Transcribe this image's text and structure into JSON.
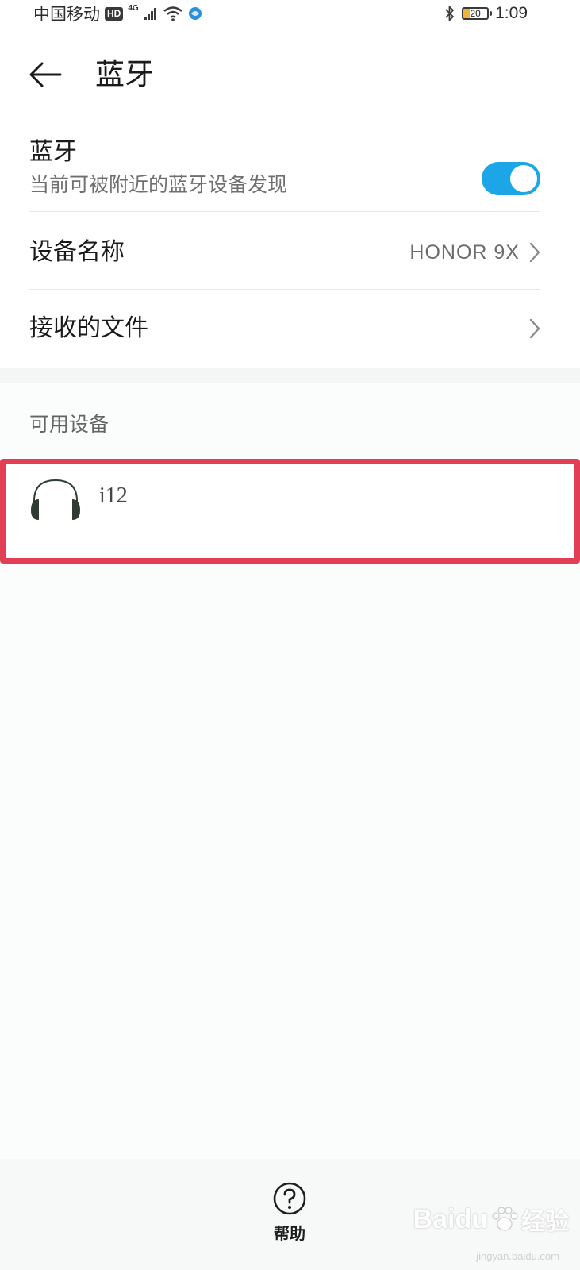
{
  "status_bar": {
    "carrier": "中国移动",
    "hd": "HD",
    "network_type": "4G",
    "battery_level": "20",
    "time": "1:09"
  },
  "header": {
    "title": "蓝牙"
  },
  "settings": {
    "bluetooth": {
      "label": "蓝牙",
      "subtitle": "当前可被附近的蓝牙设备发现",
      "enabled": true
    },
    "device_name": {
      "label": "设备名称",
      "value": "HONOR 9X"
    },
    "received_files": {
      "label": "接收的文件"
    }
  },
  "available_devices": {
    "section_label": "可用设备",
    "items": [
      {
        "name": "i12",
        "icon": "headphones-icon"
      }
    ]
  },
  "bottom_bar": {
    "help_label": "帮助"
  },
  "watermark": {
    "brand": "Baidu",
    "suffix": "经验",
    "url": "jingyan.baidu.com"
  },
  "colors": {
    "accent": "#1ca6e8",
    "highlight": "#e23f56"
  }
}
